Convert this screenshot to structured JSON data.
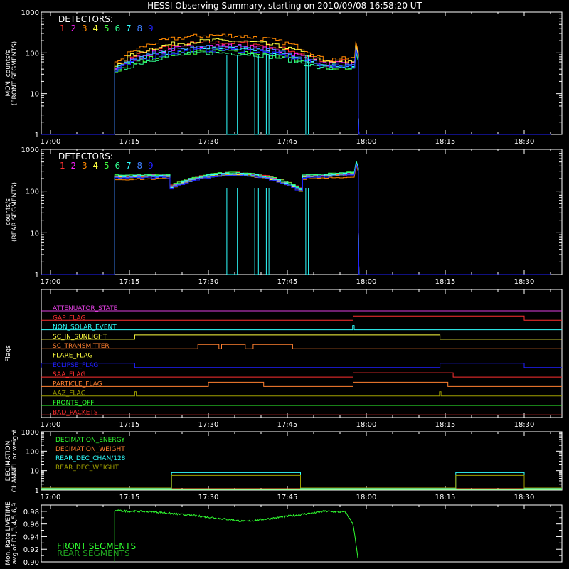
{
  "title": "HESSI Observing Summary, starting on 2010/09/08 16:58:20 UT",
  "colors": {
    "white": "#ffffff",
    "det": [
      "#ff3030",
      "#ff20ff",
      "#ff8800",
      "#ffff40",
      "#40ff40",
      "#30ff90",
      "#30ffff",
      "#4080ff",
      "#2020ff"
    ],
    "flags": [
      "#e040e0",
      "#ff3030",
      "#30ffff",
      "#ffff40",
      "#ff8030",
      "#ffff40",
      "#2020ff",
      "#ff3030",
      "#ff8030",
      "#a0a000",
      "#30ff30",
      "#ff3030"
    ],
    "decimation": [
      "#30ff30",
      "#ff8030",
      "#30ffff",
      "#a0a000"
    ],
    "livetime": [
      "#30ff30",
      "#20a020"
    ]
  },
  "chart_data": [
    {
      "type": "line",
      "name": "front-segments",
      "ylabel": [
        "MON. counts/s",
        "(FRONT SEGMENTS)"
      ],
      "yscale": "log",
      "ylim": [
        1,
        1000
      ],
      "yticks": [
        "1",
        "10",
        "100",
        "1000"
      ],
      "xticks": [
        "17:00",
        "17:15",
        "17:30",
        "17:45",
        "18:00",
        "18:15",
        "18:30"
      ],
      "legend_title": "DETECTORS:",
      "legend": [
        "1",
        "2",
        "3",
        "4",
        "5",
        "6",
        "7",
        "8",
        "9"
      ],
      "start_min": 12.2,
      "end_min": 58.5,
      "series_levels": [
        {
          "start": 45,
          "peak": 180,
          "end": 80
        },
        {
          "start": 40,
          "peak": 150,
          "end": 70
        },
        {
          "start": 55,
          "peak": 270,
          "end": 90
        },
        {
          "start": 48,
          "peak": 200,
          "end": 75
        },
        {
          "start": 35,
          "peak": 110,
          "end": 55
        },
        {
          "start": 32,
          "peak": 100,
          "end": 50
        },
        {
          "start": 40,
          "peak": 130,
          "end": 60
        },
        {
          "start": 38,
          "peak": 140,
          "end": 65
        },
        {
          "start": 36,
          "peak": 120,
          "end": 60
        }
      ]
    },
    {
      "type": "line",
      "name": "rear-segments",
      "ylabel": [
        "counts/s",
        "(REAR SEGMENTS)"
      ],
      "yscale": "log",
      "ylim": [
        1,
        1000
      ],
      "yticks": [
        "1",
        "10",
        "100",
        "1000"
      ],
      "xticks": [
        "17:00",
        "17:15",
        "17:30",
        "17:45",
        "18:00",
        "18:15",
        "18:30"
      ],
      "legend_title": "DETECTORS:",
      "legend": [
        "1",
        "2",
        "3",
        "4",
        "5",
        "6",
        "7",
        "8",
        "9"
      ],
      "start_min": 12.2,
      "end_min": 58.5
    },
    {
      "type": "line",
      "name": "flags",
      "ylabel": [
        "Flags"
      ],
      "xticks": [
        "17:00",
        "17:15",
        "17:30",
        "17:45",
        "18:00",
        "18:15",
        "18:30"
      ],
      "flags": [
        {
          "name": "ATTENUATOR_STATE",
          "on": []
        },
        {
          "name": "GAP_FLAG",
          "on": [
            [
              57.5,
              90
            ]
          ]
        },
        {
          "name": "NON_SOLAR_EVENT",
          "on": [
            [
              57.4,
              57.7
            ]
          ]
        },
        {
          "name": "SC_IN_SUNLIGHT",
          "on": [
            [
              16.0,
              74.0
            ]
          ]
        },
        {
          "name": "SC_TRANSMITTER",
          "on": [
            [
              28.0,
              32.0
            ],
            [
              32.5,
              37.0
            ],
            [
              38.5,
              46.0
            ]
          ]
        },
        {
          "name": "FLARE_FLAG",
          "on": []
        },
        {
          "name": "ECLIPSE_FLAG",
          "on": [
            [
              -10,
              16.0
            ],
            [
              74.0,
              90
            ]
          ]
        },
        {
          "name": "SAA_FLAG",
          "on": [
            [
              57.5,
              76.5
            ]
          ]
        },
        {
          "name": "PARTICLE_FLAG",
          "on": [
            [
              30.0,
              40.5
            ],
            [
              57.5,
              75.5
            ]
          ]
        },
        {
          "name": "AAZ_FLAG",
          "on": [
            [
              16.0,
              16.3
            ],
            [
              73.9,
              74.2
            ]
          ]
        },
        {
          "name": "FRONTS_OFF",
          "on": []
        },
        {
          "name": "BAD_PACKETS",
          "on": []
        }
      ]
    },
    {
      "type": "line",
      "name": "decimation",
      "ylabel": [
        "DECIMATION",
        "CHANNEL or weight"
      ],
      "yscale": "log",
      "ylim": [
        1,
        1000
      ],
      "yticks": [
        "1",
        "10",
        "100",
        "1000"
      ],
      "xticks": [
        "17:00",
        "17:15",
        "17:30",
        "17:45",
        "18:00",
        "18:15",
        "18:30"
      ],
      "legend": [
        "DECIMATION_ENERGY",
        "DECIMATION_WEIGHT",
        "REAR_DEC_CHAN/128",
        "REAR_DEC_WEIGHT"
      ],
      "rear_dec_chan_on": [
        [
          23.0,
          47.5
        ],
        [
          77.0,
          90.0
        ]
      ],
      "rear_dec_chan_value": 8
    },
    {
      "type": "line",
      "name": "livetime",
      "ylabel": [
        "Mon. Rate LIVETIME",
        "avg of D1,3,4,5,6,9"
      ],
      "ylim": [
        0.9,
        0.99
      ],
      "yticks": [
        "0.90",
        "0.92",
        "0.94",
        "0.96",
        "0.98"
      ],
      "xticks": [
        "17:00",
        "17:15",
        "17:30",
        "17:45",
        "18:00",
        "18:15",
        "18:30"
      ],
      "legend": [
        "FRONT SEGMENTS",
        "REAR SEGMENTS"
      ],
      "start_min": 12.2,
      "end_min": 58.5,
      "front": [
        [
          12.2,
          0.981
        ],
        [
          20,
          0.979
        ],
        [
          30,
          0.971
        ],
        [
          37,
          0.964
        ],
        [
          45,
          0.972
        ],
        [
          52,
          0.98
        ],
        [
          56,
          0.979
        ],
        [
          57.5,
          0.96
        ],
        [
          58.5,
          0.9
        ]
      ]
    }
  ]
}
